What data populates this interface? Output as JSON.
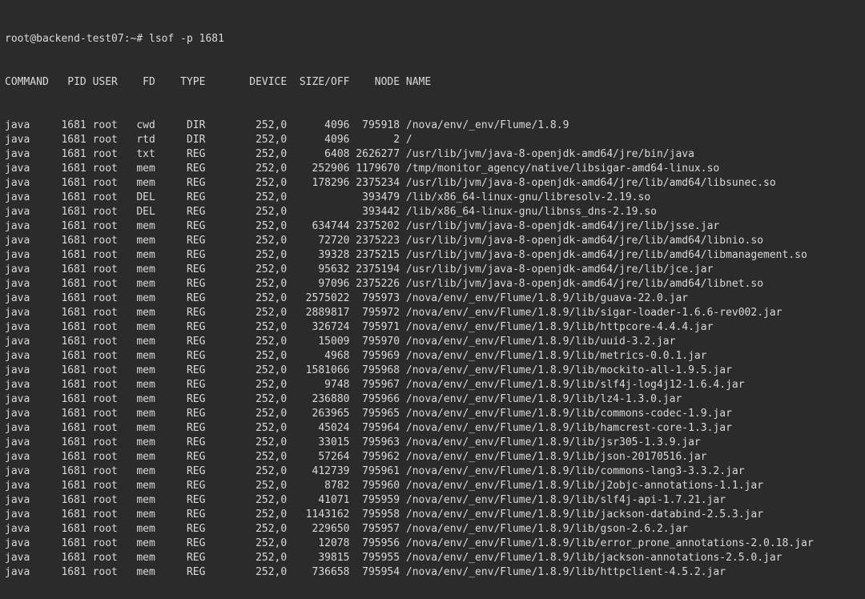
{
  "prompt": {
    "user_host": "root@backend-test07",
    "cwd": "~",
    "symbol": "#",
    "command": "lsof -p 1681"
  },
  "header": {
    "command": "COMMAND",
    "pid": "PID",
    "user": "USER",
    "fd": "FD",
    "type": "TYPE",
    "device": "DEVICE",
    "size_off": "SIZE/OFF",
    "node": "NODE",
    "name": "NAME"
  },
  "rows": [
    {
      "command": "java",
      "pid": "1681",
      "user": "root",
      "fd": "cwd",
      "type": "DIR",
      "device": "252,0",
      "size_off": "4096",
      "node": "795918",
      "name": "/nova/env/_env/Flume/1.8.9"
    },
    {
      "command": "java",
      "pid": "1681",
      "user": "root",
      "fd": "rtd",
      "type": "DIR",
      "device": "252,0",
      "size_off": "4096",
      "node": "2",
      "name": "/"
    },
    {
      "command": "java",
      "pid": "1681",
      "user": "root",
      "fd": "txt",
      "type": "REG",
      "device": "252,0",
      "size_off": "6408",
      "node": "2626277",
      "name": "/usr/lib/jvm/java-8-openjdk-amd64/jre/bin/java"
    },
    {
      "command": "java",
      "pid": "1681",
      "user": "root",
      "fd": "mem",
      "type": "REG",
      "device": "252,0",
      "size_off": "252906",
      "node": "1179670",
      "name": "/tmp/monitor_agency/native/libsigar-amd64-linux.so"
    },
    {
      "command": "java",
      "pid": "1681",
      "user": "root",
      "fd": "mem",
      "type": "REG",
      "device": "252,0",
      "size_off": "178296",
      "node": "2375234",
      "name": "/usr/lib/jvm/java-8-openjdk-amd64/jre/lib/amd64/libsunec.so"
    },
    {
      "command": "java",
      "pid": "1681",
      "user": "root",
      "fd": "DEL",
      "type": "REG",
      "device": "252,0",
      "size_off": "",
      "node": "393479",
      "name": "/lib/x86_64-linux-gnu/libresolv-2.19.so"
    },
    {
      "command": "java",
      "pid": "1681",
      "user": "root",
      "fd": "DEL",
      "type": "REG",
      "device": "252,0",
      "size_off": "",
      "node": "393442",
      "name": "/lib/x86_64-linux-gnu/libnss_dns-2.19.so"
    },
    {
      "command": "java",
      "pid": "1681",
      "user": "root",
      "fd": "mem",
      "type": "REG",
      "device": "252,0",
      "size_off": "634744",
      "node": "2375202",
      "name": "/usr/lib/jvm/java-8-openjdk-amd64/jre/lib/jsse.jar"
    },
    {
      "command": "java",
      "pid": "1681",
      "user": "root",
      "fd": "mem",
      "type": "REG",
      "device": "252,0",
      "size_off": "72720",
      "node": "2375223",
      "name": "/usr/lib/jvm/java-8-openjdk-amd64/jre/lib/amd64/libnio.so"
    },
    {
      "command": "java",
      "pid": "1681",
      "user": "root",
      "fd": "mem",
      "type": "REG",
      "device": "252,0",
      "size_off": "39328",
      "node": "2375215",
      "name": "/usr/lib/jvm/java-8-openjdk-amd64/jre/lib/amd64/libmanagement.so"
    },
    {
      "command": "java",
      "pid": "1681",
      "user": "root",
      "fd": "mem",
      "type": "REG",
      "device": "252,0",
      "size_off": "95632",
      "node": "2375194",
      "name": "/usr/lib/jvm/java-8-openjdk-amd64/jre/lib/jce.jar"
    },
    {
      "command": "java",
      "pid": "1681",
      "user": "root",
      "fd": "mem",
      "type": "REG",
      "device": "252,0",
      "size_off": "97096",
      "node": "2375226",
      "name": "/usr/lib/jvm/java-8-openjdk-amd64/jre/lib/amd64/libnet.so"
    },
    {
      "command": "java",
      "pid": "1681",
      "user": "root",
      "fd": "mem",
      "type": "REG",
      "device": "252,0",
      "size_off": "2575022",
      "node": "795973",
      "name": "/nova/env/_env/Flume/1.8.9/lib/guava-22.0.jar"
    },
    {
      "command": "java",
      "pid": "1681",
      "user": "root",
      "fd": "mem",
      "type": "REG",
      "device": "252,0",
      "size_off": "2889817",
      "node": "795972",
      "name": "/nova/env/_env/Flume/1.8.9/lib/sigar-loader-1.6.6-rev002.jar"
    },
    {
      "command": "java",
      "pid": "1681",
      "user": "root",
      "fd": "mem",
      "type": "REG",
      "device": "252,0",
      "size_off": "326724",
      "node": "795971",
      "name": "/nova/env/_env/Flume/1.8.9/lib/httpcore-4.4.4.jar"
    },
    {
      "command": "java",
      "pid": "1681",
      "user": "root",
      "fd": "mem",
      "type": "REG",
      "device": "252,0",
      "size_off": "15009",
      "node": "795970",
      "name": "/nova/env/_env/Flume/1.8.9/lib/uuid-3.2.jar"
    },
    {
      "command": "java",
      "pid": "1681",
      "user": "root",
      "fd": "mem",
      "type": "REG",
      "device": "252,0",
      "size_off": "4968",
      "node": "795969",
      "name": "/nova/env/_env/Flume/1.8.9/lib/metrics-0.0.1.jar"
    },
    {
      "command": "java",
      "pid": "1681",
      "user": "root",
      "fd": "mem",
      "type": "REG",
      "device": "252,0",
      "size_off": "1581066",
      "node": "795968",
      "name": "/nova/env/_env/Flume/1.8.9/lib/mockito-all-1.9.5.jar"
    },
    {
      "command": "java",
      "pid": "1681",
      "user": "root",
      "fd": "mem",
      "type": "REG",
      "device": "252,0",
      "size_off": "9748",
      "node": "795967",
      "name": "/nova/env/_env/Flume/1.8.9/lib/slf4j-log4j12-1.6.4.jar"
    },
    {
      "command": "java",
      "pid": "1681",
      "user": "root",
      "fd": "mem",
      "type": "REG",
      "device": "252,0",
      "size_off": "236880",
      "node": "795966",
      "name": "/nova/env/_env/Flume/1.8.9/lib/lz4-1.3.0.jar"
    },
    {
      "command": "java",
      "pid": "1681",
      "user": "root",
      "fd": "mem",
      "type": "REG",
      "device": "252,0",
      "size_off": "263965",
      "node": "795965",
      "name": "/nova/env/_env/Flume/1.8.9/lib/commons-codec-1.9.jar"
    },
    {
      "command": "java",
      "pid": "1681",
      "user": "root",
      "fd": "mem",
      "type": "REG",
      "device": "252,0",
      "size_off": "45024",
      "node": "795964",
      "name": "/nova/env/_env/Flume/1.8.9/lib/hamcrest-core-1.3.jar"
    },
    {
      "command": "java",
      "pid": "1681",
      "user": "root",
      "fd": "mem",
      "type": "REG",
      "device": "252,0",
      "size_off": "33015",
      "node": "795963",
      "name": "/nova/env/_env/Flume/1.8.9/lib/jsr305-1.3.9.jar"
    },
    {
      "command": "java",
      "pid": "1681",
      "user": "root",
      "fd": "mem",
      "type": "REG",
      "device": "252,0",
      "size_off": "57264",
      "node": "795962",
      "name": "/nova/env/_env/Flume/1.8.9/lib/json-20170516.jar"
    },
    {
      "command": "java",
      "pid": "1681",
      "user": "root",
      "fd": "mem",
      "type": "REG",
      "device": "252,0",
      "size_off": "412739",
      "node": "795961",
      "name": "/nova/env/_env/Flume/1.8.9/lib/commons-lang3-3.3.2.jar"
    },
    {
      "command": "java",
      "pid": "1681",
      "user": "root",
      "fd": "mem",
      "type": "REG",
      "device": "252,0",
      "size_off": "8782",
      "node": "795960",
      "name": "/nova/env/_env/Flume/1.8.9/lib/j2objc-annotations-1.1.jar"
    },
    {
      "command": "java",
      "pid": "1681",
      "user": "root",
      "fd": "mem",
      "type": "REG",
      "device": "252,0",
      "size_off": "41071",
      "node": "795959",
      "name": "/nova/env/_env/Flume/1.8.9/lib/slf4j-api-1.7.21.jar"
    },
    {
      "command": "java",
      "pid": "1681",
      "user": "root",
      "fd": "mem",
      "type": "REG",
      "device": "252,0",
      "size_off": "1143162",
      "node": "795958",
      "name": "/nova/env/_env/Flume/1.8.9/lib/jackson-databind-2.5.3.jar"
    },
    {
      "command": "java",
      "pid": "1681",
      "user": "root",
      "fd": "mem",
      "type": "REG",
      "device": "252,0",
      "size_off": "229650",
      "node": "795957",
      "name": "/nova/env/_env/Flume/1.8.9/lib/gson-2.6.2.jar"
    },
    {
      "command": "java",
      "pid": "1681",
      "user": "root",
      "fd": "mem",
      "type": "REG",
      "device": "252,0",
      "size_off": "12078",
      "node": "795956",
      "name": "/nova/env/_env/Flume/1.8.9/lib/error_prone_annotations-2.0.18.jar"
    },
    {
      "command": "java",
      "pid": "1681",
      "user": "root",
      "fd": "mem",
      "type": "REG",
      "device": "252,0",
      "size_off": "39815",
      "node": "795955",
      "name": "/nova/env/_env/Flume/1.8.9/lib/jackson-annotations-2.5.0.jar"
    },
    {
      "command": "java",
      "pid": "1681",
      "user": "root",
      "fd": "mem",
      "type": "REG",
      "device": "252,0",
      "size_off": "736658",
      "node": "795954",
      "name": "/nova/env/_env/Flume/1.8.9/lib/httpclient-4.5.2.jar"
    }
  ]
}
